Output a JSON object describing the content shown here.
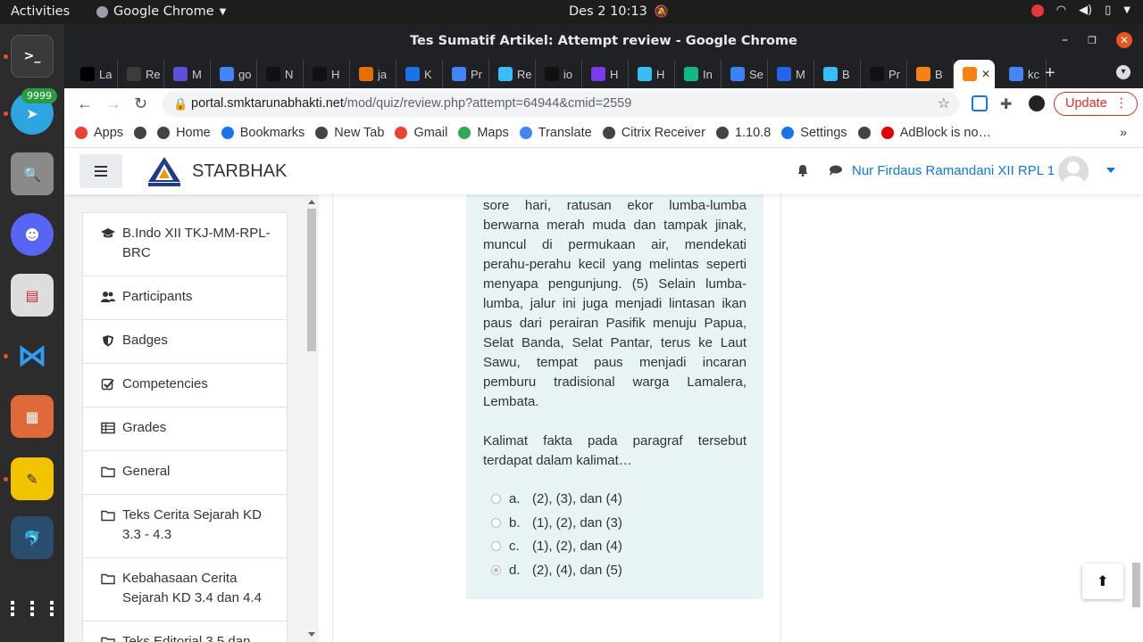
{
  "topbar": {
    "activities": "Activities",
    "app": "Google Chrome",
    "clock": "Des 2  10:13"
  },
  "dock": {
    "telegram_badge": "9999"
  },
  "window": {
    "title": "Tes Sumatif Artikel: Attempt review - Google Chrome"
  },
  "tabs": [
    {
      "label": "La",
      "icon": "dev-icon",
      "color": "#000000"
    },
    {
      "label": "Re",
      "icon": "f-icon",
      "color": "#3c3c3c"
    },
    {
      "label": "M",
      "icon": "glasses-icon",
      "color": "#5b51d8"
    },
    {
      "label": "go",
      "icon": "google-icon",
      "color": "#4285f4"
    },
    {
      "label": "N",
      "icon": "github-icon",
      "color": "#111111"
    },
    {
      "label": "H",
      "icon": "triangle-icon",
      "color": "#111111"
    },
    {
      "label": "ja",
      "icon": "java-icon",
      "color": "#e76f00"
    },
    {
      "label": "K",
      "icon": "circle-icon",
      "color": "#1a73e8"
    },
    {
      "label": "Pr",
      "icon": "docs-icon",
      "color": "#4285f4"
    },
    {
      "label": "Re",
      "icon": "wave-icon",
      "color": "#38bdf8"
    },
    {
      "label": "io",
      "icon": "github-icon",
      "color": "#111111"
    },
    {
      "label": "H",
      "icon": "shield-icon",
      "color": "#7c3aed"
    },
    {
      "label": "H",
      "icon": "wave-icon",
      "color": "#38bdf8"
    },
    {
      "label": "In",
      "icon": "leaf-icon",
      "color": "#10b981"
    },
    {
      "label": "Se",
      "icon": "robot-icon",
      "color": "#3b82f6"
    },
    {
      "label": "M",
      "icon": "m-icon",
      "color": "#2563eb"
    },
    {
      "label": "B",
      "icon": "wave-icon",
      "color": "#38bdf8"
    },
    {
      "label": "Pr",
      "icon": "trello-icon",
      "color": "#111111"
    },
    {
      "label": "B",
      "icon": "moodle-icon",
      "color": "#f98012"
    },
    {
      "label": "",
      "icon": "moodle-icon",
      "color": "#f98012",
      "active": true
    },
    {
      "label": "kc",
      "icon": "google-icon",
      "color": "#4285f4"
    }
  ],
  "address": {
    "host": "portal.smktarunabhakti.net",
    "path": "/mod/quiz/review.php?attempt=64944&cmid=2559"
  },
  "toolbar": {
    "update_label": "Update"
  },
  "bookmarks": [
    {
      "label": "Apps",
      "icon": "apps-grid-icon",
      "color": "#ea4335"
    },
    {
      "label": "",
      "icon": "globe-icon",
      "color": "#444444"
    },
    {
      "label": "Home",
      "icon": "globe-icon",
      "color": "#444444"
    },
    {
      "label": "Bookmarks",
      "icon": "star-icon",
      "color": "#1a73e8"
    },
    {
      "label": "New Tab",
      "icon": "globe-icon",
      "color": "#444444"
    },
    {
      "label": "Gmail",
      "icon": "gmail-icon",
      "color": "#ea4335"
    },
    {
      "label": "Maps",
      "icon": "maps-icon",
      "color": "#34a853"
    },
    {
      "label": "Translate",
      "icon": "translate-icon",
      "color": "#4285f4"
    },
    {
      "label": "Citrix Receiver",
      "icon": "citrix-icon",
      "color": "#444444"
    },
    {
      "label": "1.10.8",
      "icon": "globe-icon",
      "color": "#444444"
    },
    {
      "label": "Settings",
      "icon": "gear-icon",
      "color": "#1a73e8"
    },
    {
      "label": "",
      "icon": "bottle-icon",
      "color": "#444444"
    },
    {
      "label": "AdBlock is no…",
      "icon": "adblock-icon",
      "color": "#e00000"
    }
  ],
  "site": {
    "brand": "STARBHAK",
    "user": "Nur Firdaus Ramandani XII RPL 1"
  },
  "drawer": {
    "items": [
      {
        "label": "B.Indo XII TKJ-MM-RPL-BRC",
        "icon": "graduation-cap-icon"
      },
      {
        "label": "Participants",
        "icon": "users-icon"
      },
      {
        "label": "Badges",
        "icon": "shield-icon"
      },
      {
        "label": "Competencies",
        "icon": "checkbox-icon"
      },
      {
        "label": "Grades",
        "icon": "table-icon"
      },
      {
        "label": "General",
        "icon": "folder-icon"
      },
      {
        "label": "Teks Cerita Sejarah KD 3.3 - 4.3",
        "icon": "folder-icon"
      },
      {
        "label": "Kebahasaan Cerita Sejarah KD 3.4 dan 4.4",
        "icon": "folder-icon"
      },
      {
        "label": "Teks Editorial 3.5 dan",
        "icon": "folder-icon"
      }
    ]
  },
  "question": {
    "passage": "sore hari, ratusan ekor lumba-lumba berwarna merah muda dan tampak jinak, muncul di permukaan air, mendekati perahu-perahu kecil yang melintas seperti menyapa pengunjung. (5) Selain lumba-lumba, jalur ini juga menjadi lintasan ikan paus dari perairan Pasifik menuju Papua, Selat Banda, Selat Pantar, terus ke Laut Sawu, tempat paus menjadi incaran pemburu tradisional warga Lamalera, Lembata.",
    "prompt": "Kalimat fakta pada paragraf tersebut terdapat dalam kalimat…",
    "answers": [
      {
        "letter": "a.",
        "text": "(2), (3), dan (4)",
        "selected": false
      },
      {
        "letter": "b.",
        "text": "(1), (2), dan (3)",
        "selected": false
      },
      {
        "letter": "c.",
        "text": "(1), (2), dan (4)",
        "selected": false
      },
      {
        "letter": "d.",
        "text": "(2), (4), dan (5)",
        "selected": true
      }
    ]
  }
}
